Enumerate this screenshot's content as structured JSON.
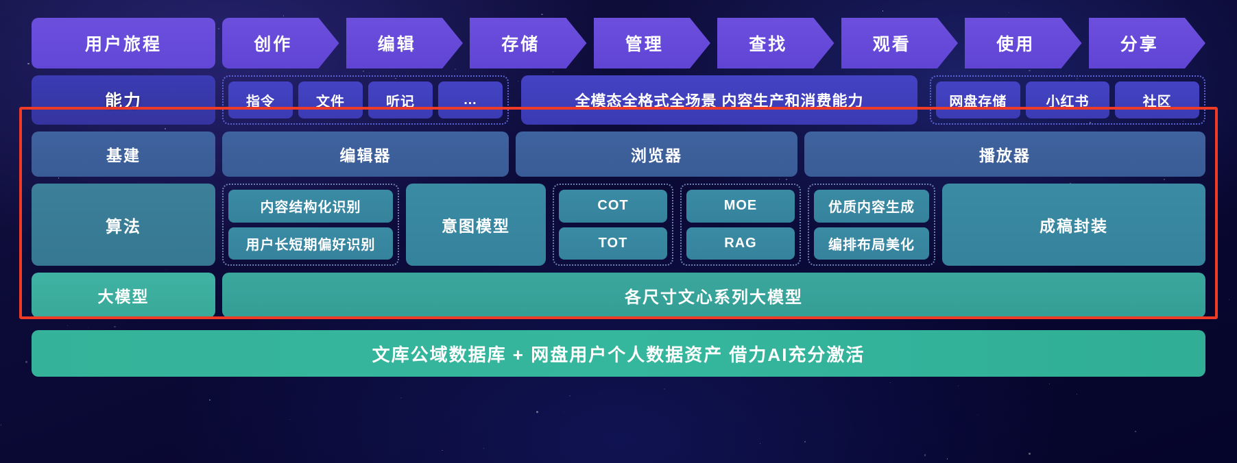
{
  "colors": {
    "journey": "#6c4fdd",
    "capability": "#3b3cb4",
    "infra": "#3f639f",
    "algorithm": "#3b8ba5",
    "model": "#3aa79d",
    "foundation": "#35b39a",
    "highlight": "#ef3b26",
    "background": "#0c0b38"
  },
  "journey_row": {
    "label": "用户旅程",
    "stages": [
      "创作",
      "编辑",
      "存储",
      "管理",
      "查找",
      "观看",
      "使用",
      "分享"
    ]
  },
  "capability_row": {
    "label": "能力",
    "group_left": [
      "指令",
      "文件",
      "听记",
      "…"
    ],
    "center_band": "全模态全格式全场景  内容生产和消费能力",
    "group_right": [
      "网盘存储",
      "小红书",
      "社区"
    ]
  },
  "infra_row": {
    "label": "基建",
    "items": [
      "编辑器",
      "浏览器",
      "播放器"
    ]
  },
  "algorithm_row": {
    "label": "算法",
    "group_structure": [
      "内容结构化识别",
      "用户长短期偏好识别"
    ],
    "intent_model": "意图模型",
    "group_cot": [
      "COT",
      "TOT"
    ],
    "group_moe": [
      "MOE",
      "RAG"
    ],
    "group_generation": [
      "优质内容生成",
      "编排布局美化"
    ],
    "final_package": "成稿封装"
  },
  "model_row": {
    "label": "大模型",
    "band": "各尺寸文心系列大模型"
  },
  "foundation_row": {
    "band": "文库公域数据库 + 网盘用户个人数据资产  借力AI充分激活"
  }
}
